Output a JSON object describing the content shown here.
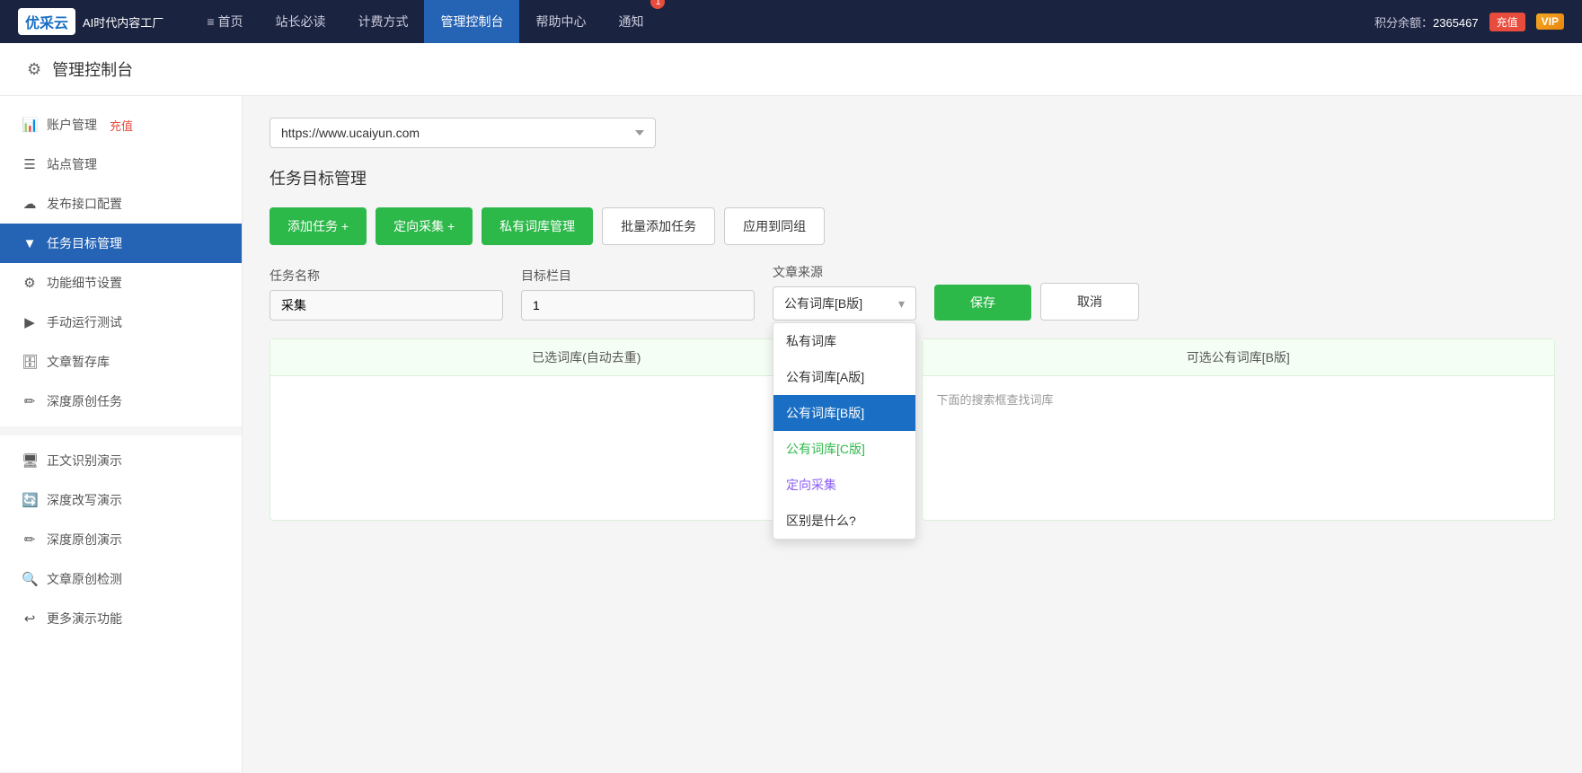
{
  "topNav": {
    "logo": {
      "iconText": "优采云",
      "subtitle": "AI时代内容工厂"
    },
    "items": [
      {
        "id": "home",
        "label": "首页",
        "icon": "≡",
        "active": false
      },
      {
        "id": "must-read",
        "label": "站长必读",
        "icon": "",
        "active": false
      },
      {
        "id": "pricing",
        "label": "计费方式",
        "icon": "",
        "active": false
      },
      {
        "id": "dashboard",
        "label": "管理控制台",
        "icon": "",
        "active": true
      },
      {
        "id": "help",
        "label": "帮助中心",
        "icon": "",
        "active": false
      },
      {
        "id": "notify",
        "label": "通知",
        "icon": "🔔",
        "active": false
      }
    ],
    "notificationCount": "1",
    "pointsLabel": "积分余额：",
    "pointsAmount": "2365467",
    "rechargeLabel": "充值",
    "vipLabel": "VIP"
  },
  "pageHeader": {
    "title": "管理控制台"
  },
  "sidebar": {
    "items": [
      {
        "id": "account",
        "label": "账户管理",
        "icon": "📊",
        "active": false,
        "extra": "充值"
      },
      {
        "id": "site",
        "label": "站点管理",
        "icon": "☰",
        "active": false
      },
      {
        "id": "publish",
        "label": "发布接口配置",
        "icon": "☁",
        "active": false
      },
      {
        "id": "task",
        "label": "任务目标管理",
        "icon": "▼",
        "active": true
      },
      {
        "id": "settings",
        "label": "功能细节设置",
        "icon": "⚙",
        "active": false
      },
      {
        "id": "manual",
        "label": "手动运行测试",
        "icon": "▶",
        "active": false
      },
      {
        "id": "draft",
        "label": "文章暂存库",
        "icon": "🗄",
        "active": false
      },
      {
        "id": "original",
        "label": "深度原创任务",
        "icon": "✏",
        "active": false
      }
    ],
    "demoItems": [
      {
        "id": "ocr",
        "label": "正文识别演示",
        "icon": "🖥"
      },
      {
        "id": "rewrite",
        "label": "深度改写演示",
        "icon": "🔄"
      },
      {
        "id": "create",
        "label": "深度原创演示",
        "icon": "✏"
      },
      {
        "id": "check",
        "label": "文章原创检测",
        "icon": "🔍"
      },
      {
        "id": "more",
        "label": "更多演示功能",
        "icon": "↩"
      }
    ]
  },
  "content": {
    "urlOptions": [
      "https://www.ucaiyun.com"
    ],
    "selectedUrl": "https://www.ucaiyun.com",
    "sectionTitle": "任务目标管理",
    "toolbar": {
      "addTask": "添加任务 +",
      "directedCollect": "定向采集 +",
      "privateLibrary": "私有词库管理",
      "batchAdd": "批量添加任务",
      "applyGroup": "应用到同组"
    },
    "form": {
      "taskNameLabel": "任务名称",
      "taskNameValue": "采集",
      "targetColLabel": "目标栏目",
      "targetColValue": "1",
      "articleSourceLabel": "文章来源",
      "articleSourceSelected": "公有词库[B版]",
      "saveLabel": "保存",
      "cancelLabel": "取消"
    },
    "dropdown": {
      "options": [
        {
          "id": "private",
          "label": "私有词库",
          "color": "default",
          "selected": false
        },
        {
          "id": "publicA",
          "label": "公有词库[A版]",
          "color": "default",
          "selected": false
        },
        {
          "id": "publicB",
          "label": "公有词库[B版]",
          "color": "default",
          "selected": true
        },
        {
          "id": "publicC",
          "label": "公有词库[C版]",
          "color": "green",
          "selected": false
        },
        {
          "id": "directed",
          "label": "定向采集",
          "color": "purple",
          "selected": false
        },
        {
          "id": "difference",
          "label": "区别是什么?",
          "color": "default",
          "selected": false
        }
      ]
    },
    "wordbanks": {
      "leftPanel": {
        "header": "已选词库(自动去重)",
        "hintText": ""
      },
      "rightPanel": {
        "header": "可选公有词库[B版]",
        "hintText": "下面的搜索框查找词库"
      }
    }
  }
}
